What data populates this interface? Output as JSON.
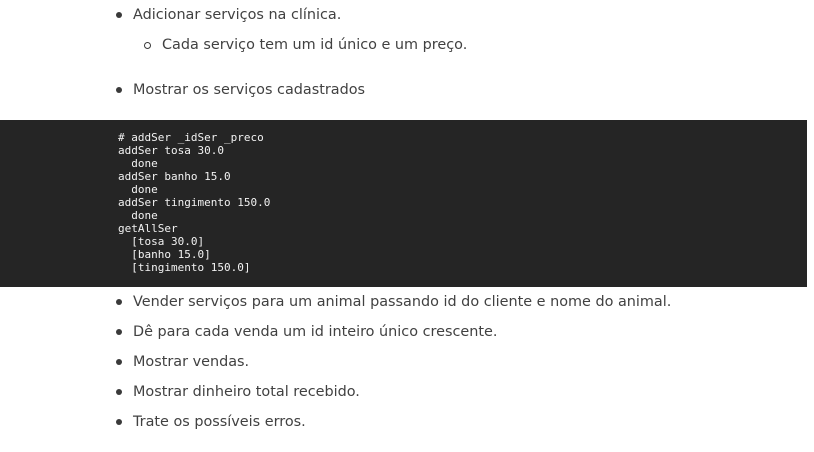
{
  "list_top": {
    "items": [
      {
        "text": "Adicionar serviços na clínica.",
        "level": 1
      },
      {
        "text": "Cada serviço tem um id único e um preço.",
        "level": 2
      },
      {
        "text": "Mostrar os serviços cadastrados",
        "level": 1
      }
    ]
  },
  "code": {
    "lines": [
      "# addSer _idSer _preco",
      "addSer tosa 30.0",
      "  done",
      "addSer banho 15.0",
      "  done",
      "addSer tingimento 150.0",
      "  done",
      "getAllSer",
      "  [tosa 30.0]",
      "  [banho 15.0]",
      "  [tingimento 150.0]"
    ]
  },
  "list_bottom": {
    "items": [
      {
        "text": "Vender serviços para um animal passando id do cliente e nome do animal."
      },
      {
        "text": "Dê para cada venda um id inteiro único crescente."
      },
      {
        "text": "Mostrar vendas."
      },
      {
        "text": "Mostrar dinheiro total recebido."
      },
      {
        "text": "Trate os possíveis erros."
      }
    ]
  }
}
